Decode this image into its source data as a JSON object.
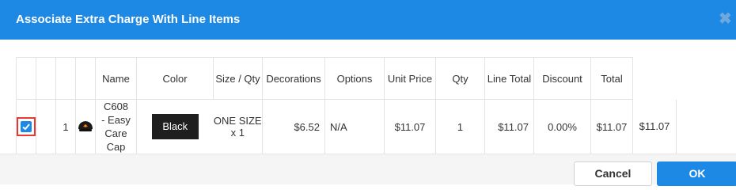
{
  "dialog": {
    "title": "Associate Extra Charge With Line Items",
    "close_icon": "close-x-icon"
  },
  "table": {
    "headers": [
      "",
      "",
      "",
      "",
      "Name",
      "Color",
      "Size / Qty",
      "Decorations",
      "Options",
      "Unit Price",
      "Qty",
      "Line Total",
      "Discount",
      "Total"
    ],
    "rows": [
      {
        "checked": true,
        "line_number": "1",
        "image_icon": "black-cap-icon",
        "name": "C608 - Easy Care Cap",
        "color": "Black",
        "size_qty": "ONE SIZE x 1",
        "decorations": "$6.52",
        "options": "N/A",
        "unit_price": "$11.07",
        "qty": "1",
        "line_total": "$11.07",
        "discount": "0.00%",
        "total": "$11.07",
        "extra": "$11.07"
      }
    ]
  },
  "footer": {
    "cancel_label": "Cancel",
    "ok_label": "OK"
  },
  "colors": {
    "accent": "#1e88e5",
    "checkbox_highlight": "#e53935",
    "swatch_black": "#1f1f1f"
  }
}
